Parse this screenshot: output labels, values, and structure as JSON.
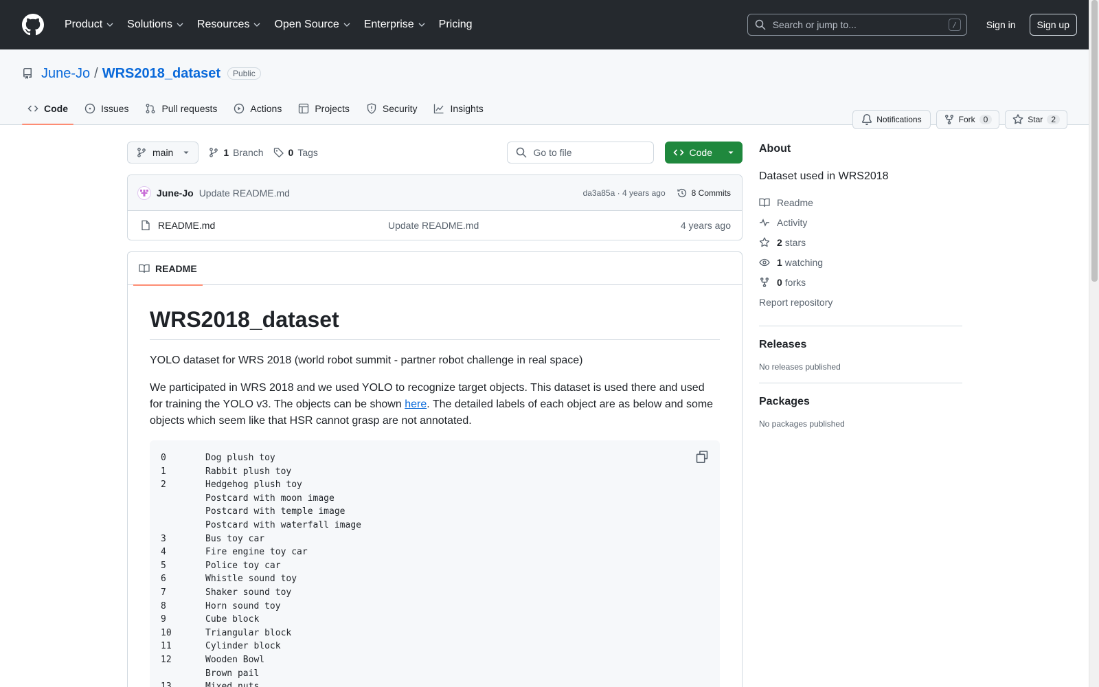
{
  "header": {
    "nav": [
      "Product",
      "Solutions",
      "Resources",
      "Open Source",
      "Enterprise",
      "Pricing"
    ],
    "search_placeholder": "Search or jump to...",
    "search_shortcut": "/",
    "signin": "Sign in",
    "signup": "Sign up"
  },
  "repo": {
    "owner": "June-Jo",
    "separator": "/",
    "name": "WRS2018_dataset",
    "visibility": "Public",
    "notifications_label": "Notifications",
    "fork_label": "Fork",
    "fork_count": "0",
    "star_label": "Star",
    "star_count": "2",
    "tabs": [
      "Code",
      "Issues",
      "Pull requests",
      "Actions",
      "Projects",
      "Security",
      "Insights"
    ]
  },
  "toolbar": {
    "branch": "main",
    "branch_count": "1",
    "branch_label": "Branch",
    "tag_count": "0",
    "tag_label": "Tags",
    "goto_placeholder": "Go to file",
    "code_label": "Code"
  },
  "commit": {
    "author": "June-Jo",
    "message": "Update README.md",
    "hash": "da3a85a · 4 years ago",
    "commits_label": "8 Commits"
  },
  "files": [
    {
      "name": "README.md",
      "message": "Update README.md",
      "age": "4 years ago"
    }
  ],
  "readme": {
    "tab_label": "README",
    "title": "WRS2018_dataset",
    "p1": "YOLO dataset for WRS 2018 (world robot summit - partner robot challenge in real space)",
    "p2_before": "We participated in WRS 2018 and we used YOLO to recognize target objects. This dataset is used there and used for training the YOLO v3. The objects can be shown ",
    "p2_link": "here",
    "p2_after": ". The detailed labels of each object are as below and some objects which seem like that HSR cannot grasp are not annotated.",
    "code_lines": [
      {
        "num": "0",
        "text": "Dog plush toy"
      },
      {
        "num": "1",
        "text": "Rabbit plush toy"
      },
      {
        "num": "2",
        "text": "Hedgehog plush toy"
      },
      {
        "num": "",
        "text": "Postcard with moon image"
      },
      {
        "num": "",
        "text": "Postcard with temple image"
      },
      {
        "num": "",
        "text": "Postcard with waterfall image"
      },
      {
        "num": "3",
        "text": "Bus toy car"
      },
      {
        "num": "4",
        "text": "Fire engine toy car"
      },
      {
        "num": "5",
        "text": "Police toy car"
      },
      {
        "num": "6",
        "text": "Whistle sound toy"
      },
      {
        "num": "7",
        "text": "Shaker sound toy"
      },
      {
        "num": "8",
        "text": "Horn sound toy"
      },
      {
        "num": "9",
        "text": "Cube block"
      },
      {
        "num": "10",
        "text": "Triangular block"
      },
      {
        "num": "11",
        "text": "Cylinder block"
      },
      {
        "num": "12",
        "text": "Wooden Bowl"
      },
      {
        "num": "",
        "text": "Brown pail"
      },
      {
        "num": "13",
        "text": "Mixed nuts"
      }
    ]
  },
  "sidebar": {
    "about_title": "About",
    "description": "Dataset used in WRS2018",
    "readme": "Readme",
    "activity": "Activity",
    "stars_count": "2",
    "stars_label": "stars",
    "watching_count": "1",
    "watching_label": "watching",
    "forks_count": "0",
    "forks_label": "forks",
    "report": "Report repository",
    "releases_title": "Releases",
    "releases_empty": "No releases published",
    "packages_title": "Packages",
    "packages_empty": "No packages published"
  },
  "colors": {
    "header_bg": "#25292e",
    "link": "#0969da",
    "primary_button": "#1f883d",
    "tab_underline": "#fd8c73"
  }
}
